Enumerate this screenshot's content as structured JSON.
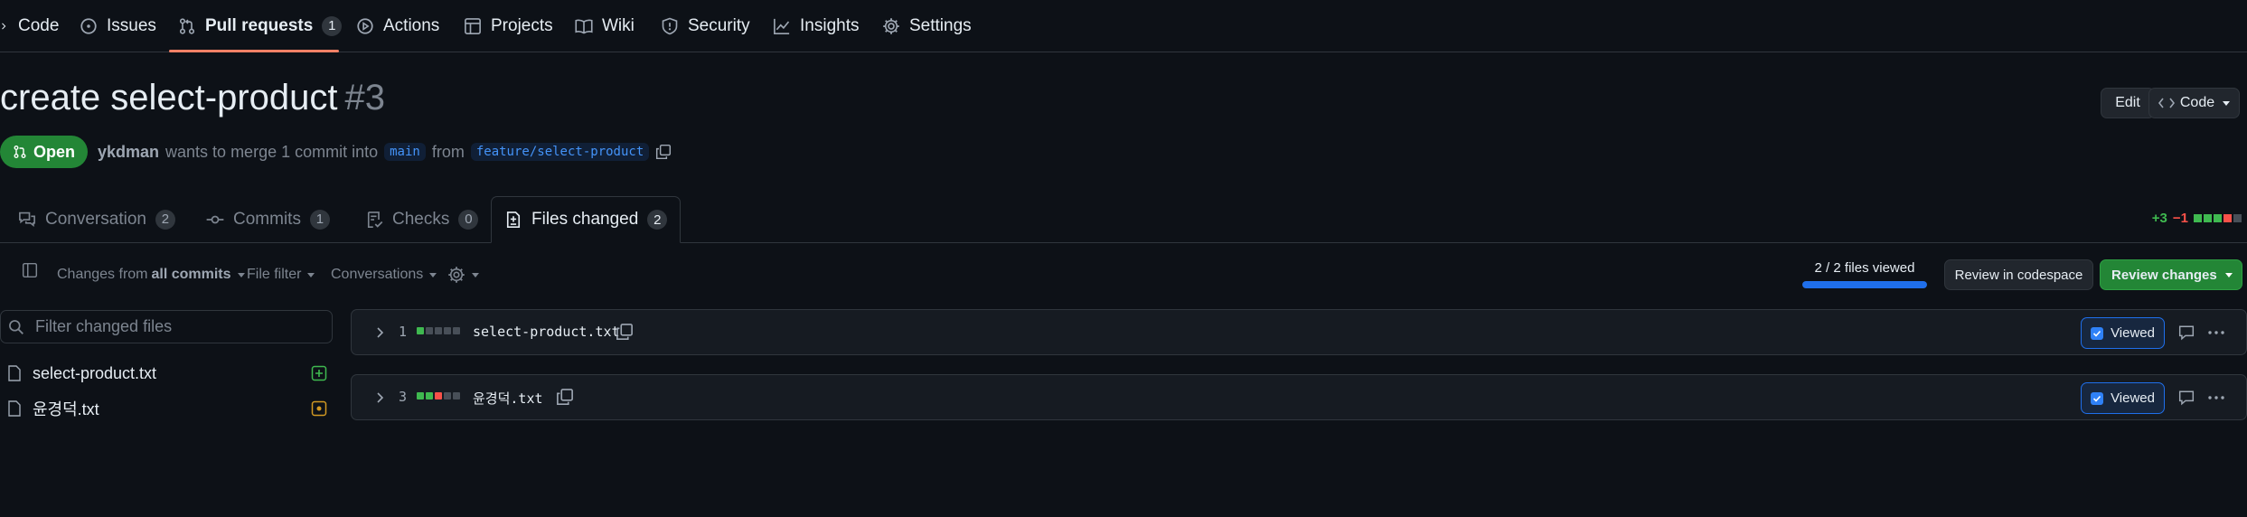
{
  "nav": {
    "items": [
      {
        "label": "Code"
      },
      {
        "label": "Issues"
      },
      {
        "label": "Pull requests",
        "count": "1"
      },
      {
        "label": "Actions"
      },
      {
        "label": "Projects"
      },
      {
        "label": "Wiki"
      },
      {
        "label": "Security"
      },
      {
        "label": "Insights"
      },
      {
        "label": "Settings"
      }
    ]
  },
  "pr": {
    "title": "create select-product",
    "number": "#3",
    "state": "Open",
    "author": "ykdman",
    "merge_text": "wants to merge 1 commit into",
    "base_branch": "main",
    "from_text": "from",
    "head_branch": "feature/select-product"
  },
  "header_buttons": {
    "edit": "Edit",
    "code": "Code"
  },
  "tabs": [
    {
      "label": "Conversation",
      "count": "2"
    },
    {
      "label": "Commits",
      "count": "1"
    },
    {
      "label": "Checks",
      "count": "0"
    },
    {
      "label": "Files changed",
      "count": "2"
    }
  ],
  "diffstat": {
    "additions": "+3",
    "deletions": "−1"
  },
  "toolbar": {
    "changes_from_prefix": "Changes from",
    "changes_from_value": "all commits",
    "file_filter": "File filter",
    "conversations": "Conversations",
    "files_viewed": "2 / 2 files viewed",
    "files_viewed_progress": 1.0,
    "review_in_codespace": "Review in codespace",
    "review_changes": "Review changes"
  },
  "file_filter_placeholder": "Filter changed files",
  "file_tree": [
    {
      "name": "select-product.txt",
      "status": "added"
    },
    {
      "name": "윤경덕.txt",
      "status": "modified"
    }
  ],
  "files": [
    {
      "changes": "1",
      "name": "select-product.txt",
      "viewed_label": "Viewed",
      "viewed": true
    },
    {
      "changes": "3",
      "name": "윤경덕.txt",
      "viewed_label": "Viewed",
      "viewed": true
    }
  ],
  "colors": {
    "background": "#0d1117",
    "accent_green": "#238636",
    "accent_blue": "#1f6feb",
    "nav_underline": "#f78166",
    "addition": "#3fb950",
    "deletion": "#f85149",
    "modified": "#d29922"
  },
  "icons": {
    "nav": [
      "code-icon",
      "issue-icon",
      "pull-request-icon",
      "actions-icon",
      "projects-icon",
      "wiki-icon",
      "shield-icon",
      "graph-icon",
      "gear-icon"
    ],
    "tabs": [
      "comment-discussion-icon",
      "commit-icon",
      "checklist-icon",
      "file-diff-icon"
    ]
  }
}
